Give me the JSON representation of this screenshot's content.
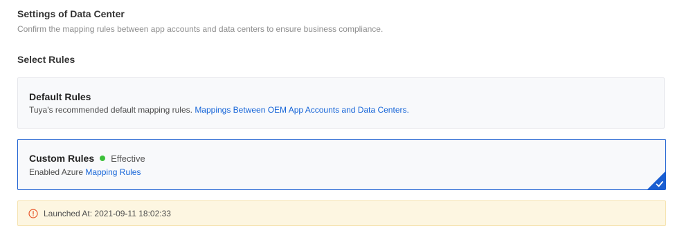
{
  "header": {
    "title": "Settings of Data Center",
    "description": "Confirm the mapping rules between app accounts and data centers to ensure business compliance."
  },
  "select": {
    "title": "Select Rules"
  },
  "rules": {
    "default": {
      "title": "Default Rules",
      "description": "Tuya's recommended default mapping rules. ",
      "link": "Mappings Between OEM App Accounts and Data Centers."
    },
    "custom": {
      "title": "Custom Rules",
      "status": "Effective",
      "description": "Enabled Azure ",
      "link": "Mapping Rules",
      "selected": true
    }
  },
  "alert": {
    "text": "Launched At: 2021-09-11 18:02:33",
    "icon": "warning-circle-icon"
  },
  "colors": {
    "accent": "#1665d8",
    "selected_border": "#1a5ed1",
    "status_green": "#3cc03a",
    "alert_bg": "#fdf6e1",
    "alert_icon": "#e8562a"
  }
}
